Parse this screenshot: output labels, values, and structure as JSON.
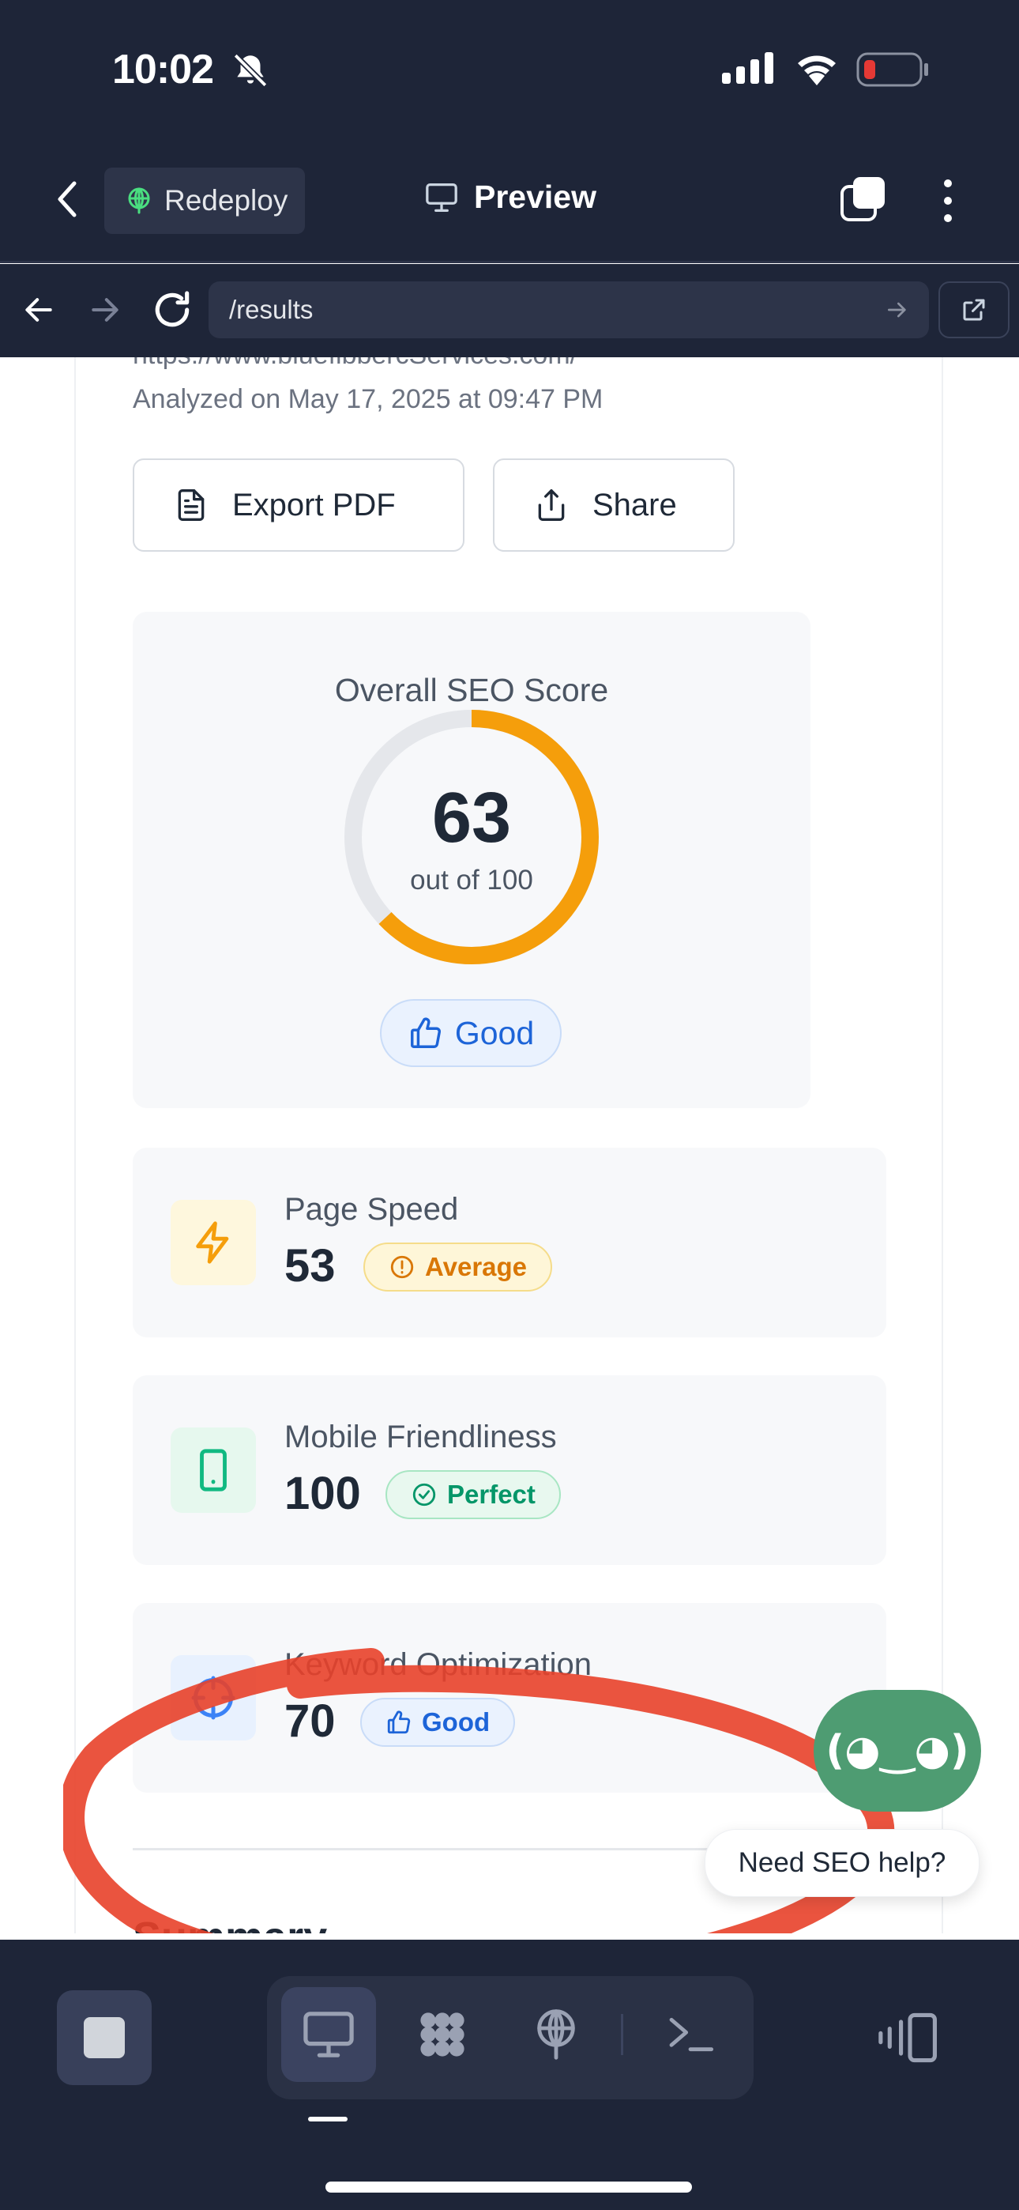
{
  "status_bar": {
    "time": "10:02"
  },
  "header": {
    "redeploy_label": "Redeploy",
    "preview_label": "Preview"
  },
  "browser": {
    "url": "/results"
  },
  "report": {
    "analyzed_text": "Analyzed on May 17, 2025 at 09:47 PM",
    "export_label": "Export PDF",
    "share_label": "Share",
    "overall": {
      "title": "Overall SEO Score",
      "score": "63",
      "out_of": "out of 100",
      "rating": "Good",
      "score_fraction": 0.63
    },
    "metrics": [
      {
        "label": "Page Speed",
        "value": "53",
        "badge": "Average",
        "icon": "lightning-icon"
      },
      {
        "label": "Mobile Friendliness",
        "value": "100",
        "badge": "Perfect",
        "icon": "phone-icon"
      },
      {
        "label": "Keyword Optimization",
        "value": "70",
        "badge": "Good",
        "icon": "crosshair-icon"
      }
    ],
    "summary_heading": "Summary"
  },
  "assistant": {
    "face": "(◕‿◕)",
    "help_text": "Need SEO help?"
  },
  "colors": {
    "header_bg": "#1e2538",
    "score_ring": "#f59e0b",
    "good": "#1d64d8",
    "perfect": "#059669",
    "average": "#d97706",
    "assistant_green": "#4e9c72",
    "annotation_red": "#e8412a"
  }
}
